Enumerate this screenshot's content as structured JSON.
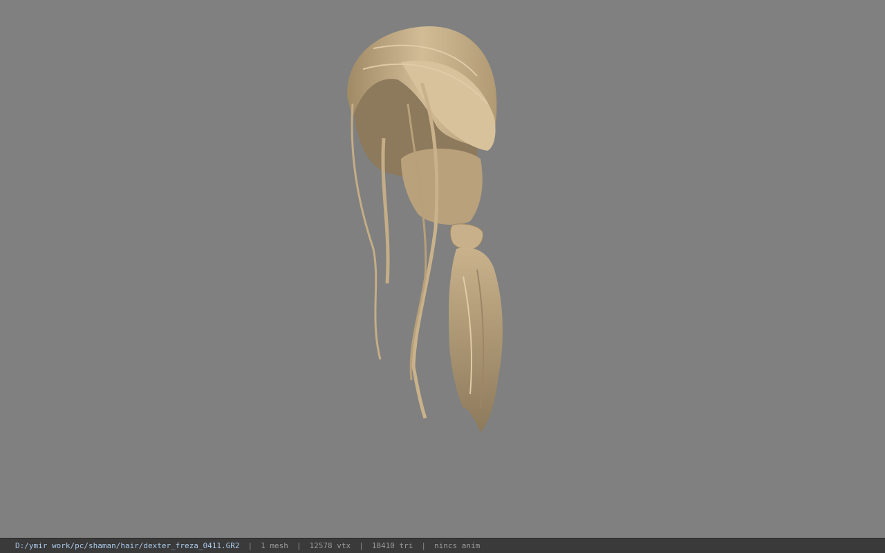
{
  "viewport": {
    "background_color": "#808080",
    "model_color": "#c7b08a",
    "model_subject": "hair mesh (ponytail)"
  },
  "status_bar": {
    "file_path": "D:/ymir work/pc/shaman/hair/dexter_freza_0411.GR2",
    "separator": "|",
    "mesh_count": "1 mesh",
    "vertex_count": "12578 vtx",
    "triangle_count": "18410 tri",
    "anim_status": "nincs anim"
  }
}
